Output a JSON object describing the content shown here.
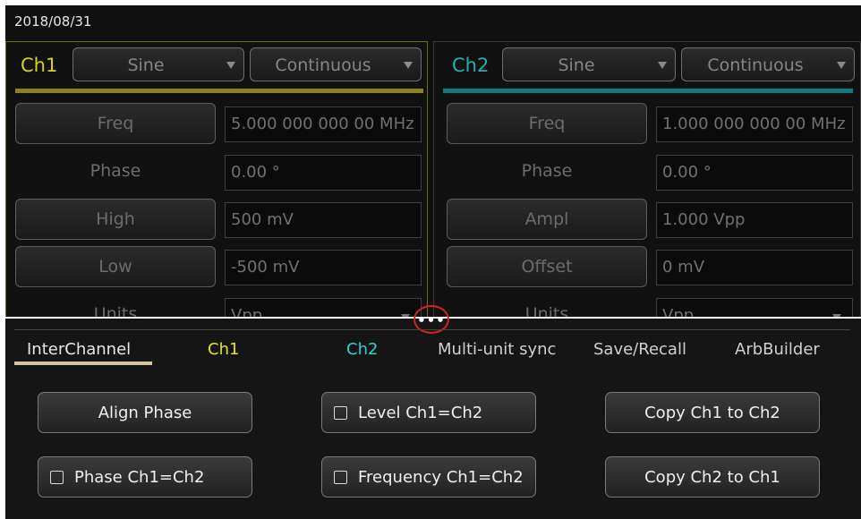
{
  "header": {
    "date": "2018/08/31"
  },
  "ch1": {
    "label": "Ch1",
    "waveform": "Sine",
    "mode": "Continuous",
    "params": [
      {
        "name": "Freq",
        "value": "5.000 000 000 00 MHz"
      },
      {
        "name": "Phase",
        "value": "0.00 °"
      },
      {
        "name": "High",
        "value": "500 mV"
      },
      {
        "name": "Low",
        "value": "-500 mV"
      },
      {
        "name": "Units",
        "value": "Vpp"
      }
    ]
  },
  "ch2": {
    "label": "Ch2",
    "waveform": "Sine",
    "mode": "Continuous",
    "params": [
      {
        "name": "Freq",
        "value": "1.000 000 000 00 MHz"
      },
      {
        "name": "Phase",
        "value": "0.00 °"
      },
      {
        "name": "Ampl",
        "value": "1.000 Vpp"
      },
      {
        "name": "Offset",
        "value": "0 mV"
      },
      {
        "name": "Units",
        "value": "Vpp"
      }
    ]
  },
  "drawer": {
    "handle": "•••",
    "tabs": [
      "InterChannel",
      "Ch1",
      "Ch2",
      "Multi-unit sync",
      "Save/Recall",
      "ArbBuilder"
    ],
    "active_tab": "InterChannel",
    "buttons": {
      "align_phase": "Align Phase",
      "level": "Level Ch1=Ch2",
      "copy_1_2": "Copy Ch1 to Ch2",
      "phase": "Phase Ch1=Ch2",
      "frequency": "Frequency Ch1=Ch2",
      "copy_2_1": "Copy Ch2 to Ch1"
    },
    "checkboxes": {
      "level": false,
      "phase": false,
      "frequency": false
    }
  },
  "colors": {
    "ch1_accent": "#d2d21e",
    "ch2_accent": "#1fb0b0",
    "highlight_ring": "#d62020",
    "active_tab_underline": "#d6c4a6"
  }
}
